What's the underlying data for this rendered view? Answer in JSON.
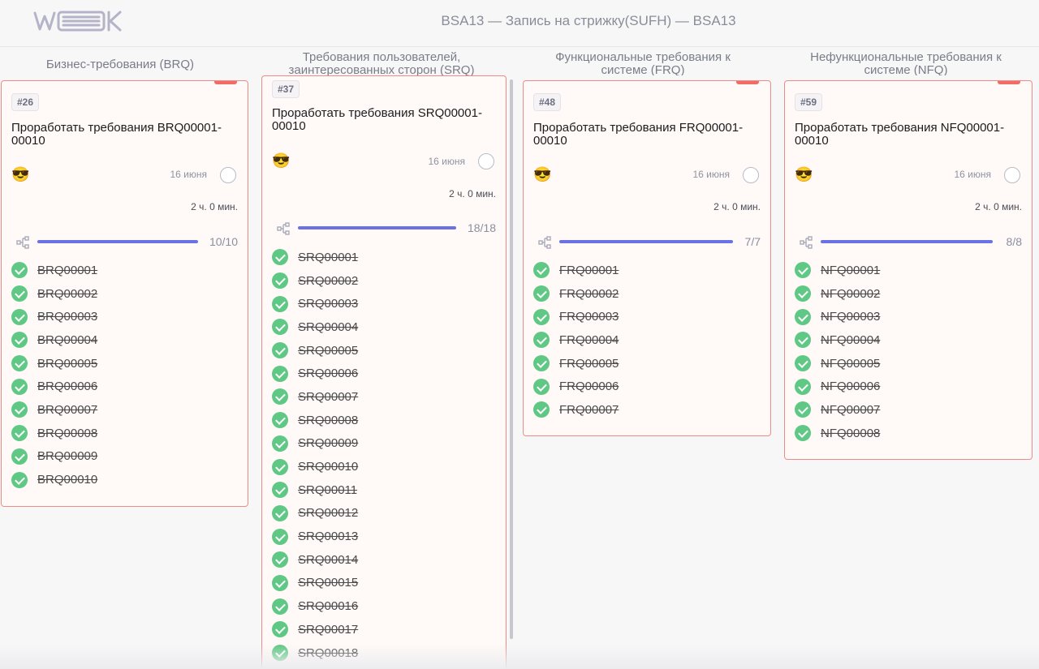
{
  "app": {
    "logo_text": "WEEEK",
    "board_title": "BSA13 — Запись на стрижку(SUFH) — BSA13"
  },
  "colors": {
    "accent": "#6b72e3",
    "card_border": "#f08a84",
    "done": "#5fc884",
    "priority_flag": "#f36b64"
  },
  "columns": [
    {
      "title": "Бизнес-требования (BRQ)",
      "card": {
        "id_tag": "#26",
        "title": "Проработать требования BRQ00001-00010",
        "emoji": "😎",
        "date": "16 июня",
        "duration": "2 ч. 0 мин.",
        "progress_text": "10/10",
        "progress_fraction": 1.0,
        "subtasks": [
          "BRQ00001",
          "BRQ00002",
          "BRQ00003",
          "BRQ00004",
          "BRQ00005",
          "BRQ00006",
          "BRQ00007",
          "BRQ00008",
          "BRQ00009",
          "BRQ00010"
        ]
      }
    },
    {
      "title": "Требования пользователей, заинтересованных сторон (SRQ)",
      "card": {
        "id_tag": "#37",
        "title": "Проработать требования SRQ00001-00010",
        "emoji": "😎",
        "date": "16 июня",
        "duration": "2 ч. 0 мин.",
        "progress_text": "18/18",
        "progress_fraction": 1.0,
        "subtasks": [
          "SRQ00001",
          "SRQ00002",
          "SRQ00003",
          "SRQ00004",
          "SRQ00005",
          "SRQ00006",
          "SRQ00007",
          "SRQ00008",
          "SRQ00009",
          "SRQ00010",
          "SRQ00011",
          "SRQ00012",
          "SRQ00013",
          "SRQ00014",
          "SRQ00015",
          "SRQ00016",
          "SRQ00017",
          "SRQ00018"
        ]
      }
    },
    {
      "title": "Функциональные требования к системе (FRQ)",
      "card": {
        "id_tag": "#48",
        "title": "Проработать требования FRQ00001-00010",
        "emoji": "😎",
        "date": "16 июня",
        "duration": "2 ч. 0 мин.",
        "progress_text": "7/7",
        "progress_fraction": 1.0,
        "subtasks": [
          "FRQ00001",
          "FRQ00002",
          "FRQ00003",
          "FRQ00004",
          "FRQ00005",
          "FRQ00006",
          "FRQ00007"
        ]
      }
    },
    {
      "title": "Нефункциональные требования к системе (NFQ)",
      "card": {
        "id_tag": "#59",
        "title": "Проработать требования NFQ00001-00010",
        "emoji": "😎",
        "date": "16 июня",
        "duration": "2 ч. 0 мин.",
        "progress_text": "8/8",
        "progress_fraction": 1.0,
        "subtasks": [
          "NFQ00001",
          "NFQ00002",
          "NFQ00003",
          "NFQ00004",
          "NFQ00005",
          "NFQ00006",
          "NFQ00007",
          "NFQ00008"
        ]
      }
    }
  ]
}
